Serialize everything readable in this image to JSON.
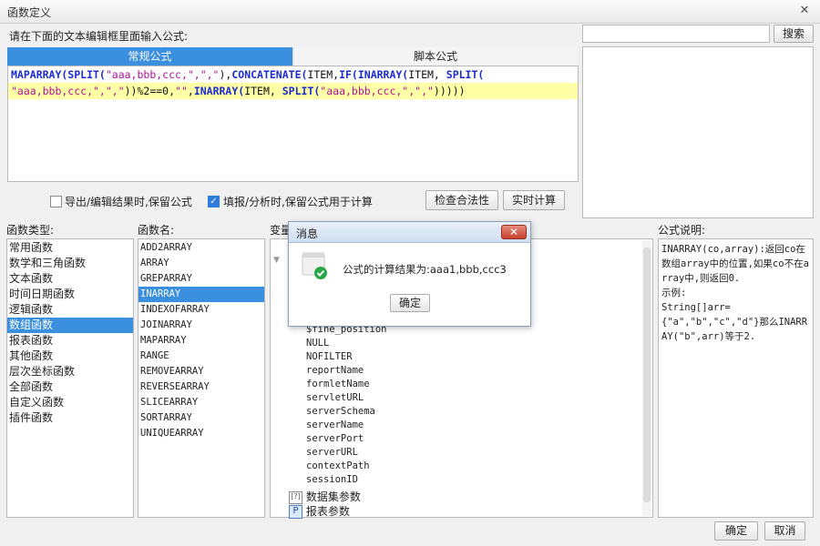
{
  "window": {
    "title": "函数定义",
    "close_glyph": "✕"
  },
  "prompt_label": "请在下面的文本编辑框里面输入公式:",
  "search": {
    "value": "",
    "button": "搜索"
  },
  "tabs": [
    {
      "label": "常规公式",
      "active": true
    },
    {
      "label": "脚本公式",
      "active": false
    }
  ],
  "editor": {
    "line1": [
      {
        "t": "MAPARRAY(",
        "k": "fn"
      },
      {
        "t": "SPLIT(",
        "k": "fn"
      },
      {
        "t": "\"aaa,bbb,ccc,\",\",\"",
        "k": "str"
      },
      {
        "t": "),",
        "k": "plain"
      },
      {
        "t": "CONCATENATE(",
        "k": "fn"
      },
      {
        "t": "ITEM,",
        "k": "plain"
      },
      {
        "t": "IF(",
        "k": "fn"
      },
      {
        "t": "INARRAY(",
        "k": "fn"
      },
      {
        "t": "ITEM, ",
        "k": "plain"
      },
      {
        "t": "SPLIT(",
        "k": "fn"
      }
    ],
    "line2": [
      {
        "t": "\"aaa,bbb,ccc,\",\",\"",
        "k": "str"
      },
      {
        "t": "))%2==0,",
        "k": "plain"
      },
      {
        "t": "\"\"",
        "k": "str"
      },
      {
        "t": ",",
        "k": "plain"
      },
      {
        "t": "INARRAY(",
        "k": "fn"
      },
      {
        "t": "ITEM, ",
        "k": "plain"
      },
      {
        "t": "SPLIT(",
        "k": "fn"
      },
      {
        "t": "\"aaa,bbb,ccc,\",\",\"",
        "k": "str"
      },
      {
        "t": ")))))",
        "k": "plain"
      }
    ]
  },
  "options": {
    "export_keep": {
      "label": "导出/编辑结果时,保留公式",
      "checked": false
    },
    "fill_keep": {
      "label": "填报/分析时,保留公式用于计算",
      "checked": true
    },
    "check_button": "检查合法性",
    "realtime_button": "实时计算"
  },
  "headers": {
    "types": "函数类型:",
    "names": "函数名:",
    "vars": "变量",
    "desc": "公式说明:"
  },
  "types": [
    "常用函数",
    "数学和三角函数",
    "文本函数",
    "时间日期函数",
    "逻辑函数",
    "数组函数",
    "报表函数",
    "其他函数",
    "层次坐标函数",
    "全部函数",
    "自定义函数",
    "插件函数"
  ],
  "types_selected": 5,
  "names": [
    "ADD2ARRAY",
    "ARRAY",
    "GREPARRAY",
    "INARRAY",
    "INDEXOFARRAY",
    "JOINARRAY",
    "MAPARRAY",
    "RANGE",
    "REMOVEARRAY",
    "REVERSEARRAY",
    "SLICEARRAY",
    "SORTARRAY",
    "UNIQUEARRAY"
  ],
  "names_selected": 3,
  "vars": [
    "$fine_position",
    "NULL",
    "NOFILTER",
    "reportName",
    "formletName",
    "servletURL",
    "serverSchema",
    "serverName",
    "serverPort",
    "serverURL",
    "contextPath",
    "sessionID"
  ],
  "var_groups": [
    {
      "label": "数据集参数",
      "icon": "dataset-param-icon"
    },
    {
      "label": "报表参数",
      "icon": "report-param-icon",
      "badge": "P"
    }
  ],
  "description": "INARRAY(co,array):返回co在数组array中的位置,如果co不在array中,则返回0.\n示例:\nString[]arr={\"a\",\"b\",\"c\",\"d\"}那么INARRAY(\"b\",arr)等于2.",
  "dialog": {
    "title": "消息",
    "message": "公式的计算结果为:aaa1,bbb,ccc3",
    "ok": "确定",
    "close_glyph": "✕"
  },
  "footer": {
    "ok": "确定",
    "cancel": "取消"
  },
  "colors": {
    "accent": "#3a8fdf",
    "function": "#1b2bd1",
    "string": "#b0129a",
    "highlight": "#ffffa6"
  }
}
